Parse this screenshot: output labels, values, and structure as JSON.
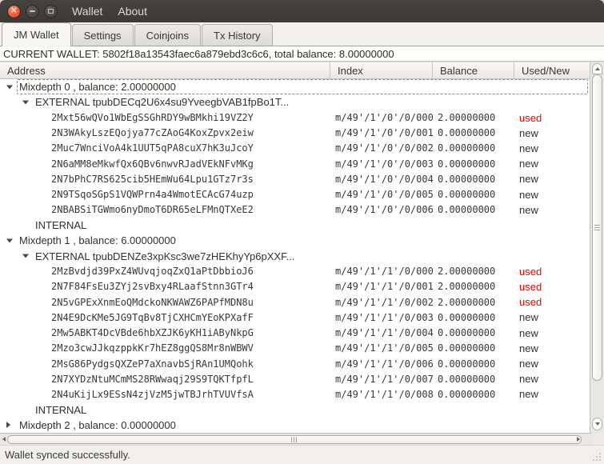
{
  "window": {
    "controls": [
      "close",
      "minimize",
      "maximize"
    ],
    "menu_items": [
      {
        "label": "Wallet"
      },
      {
        "label": "About"
      }
    ]
  },
  "tabs": [
    {
      "label": "JM Wallet",
      "active": true
    },
    {
      "label": "Settings",
      "active": false
    },
    {
      "label": "Coinjoins",
      "active": false
    },
    {
      "label": "Tx History",
      "active": false
    }
  ],
  "banner": {
    "text": "CURRENT WALLET: 5802f18a13543faec6a879ebd3c6c6, total balance: 8.00000000"
  },
  "tree": {
    "columns": [
      "Address",
      "Index",
      "Balance",
      "Used/New"
    ],
    "rows": [
      {
        "type": "mixdepth",
        "expander": "down",
        "label": "Mixdepth 0 , balance: 2.00000000",
        "focused": true
      },
      {
        "type": "branch",
        "expander": "down",
        "label": "EXTERNAL tpubDECq2U6x4su9YveegbVAB1fpBo1T..."
      },
      {
        "type": "address",
        "address": "2Mxt56wQVo1WbEgSSGhRDY9wBMkhi19VZ2Y",
        "index": "m/49'/1'/0'/0/000",
        "balance": "2.00000000",
        "status": "used"
      },
      {
        "type": "address",
        "address": "2N3WAkyLszEQojya77cZAoG4KoxZpvx2eiw",
        "index": "m/49'/1'/0'/0/001",
        "balance": "0.00000000",
        "status": "new"
      },
      {
        "type": "address",
        "address": "2Muc7WnciVoA4k1UUT5qPA8cuX7hK3uJcoY",
        "index": "m/49'/1'/0'/0/002",
        "balance": "0.00000000",
        "status": "new"
      },
      {
        "type": "address",
        "address": "2N6aMM8eMkwfQx6QBv6nwvRJadVEkNFvMKg",
        "index": "m/49'/1'/0'/0/003",
        "balance": "0.00000000",
        "status": "new"
      },
      {
        "type": "address",
        "address": "2N7bPhC7RS625cib5HEmWu64Lpu1GTz7r3s",
        "index": "m/49'/1'/0'/0/004",
        "balance": "0.00000000",
        "status": "new"
      },
      {
        "type": "address",
        "address": "2N9TSqoSGpS1VQWPrn4a4WmotECAcG74uzp",
        "index": "m/49'/1'/0'/0/005",
        "balance": "0.00000000",
        "status": "new"
      },
      {
        "type": "address",
        "address": "2NBABSiTGWmo6nyDmoT6DR65eLFMnQTXeE2",
        "index": "m/49'/1'/0'/0/006",
        "balance": "0.00000000",
        "status": "new"
      },
      {
        "type": "branch",
        "expander": null,
        "label": "INTERNAL"
      },
      {
        "type": "mixdepth",
        "expander": "down",
        "label": "Mixdepth 1 , balance: 6.00000000"
      },
      {
        "type": "branch",
        "expander": "down",
        "label": "EXTERNAL tpubDENZe3xpKsc3we7zHEKhyYp6pXXF..."
      },
      {
        "type": "address",
        "address": "2MzBvdjd39PxZ4WUvqjoqZxQ1aPtDbbioJ6",
        "index": "m/49'/1'/1'/0/000",
        "balance": "2.00000000",
        "status": "used"
      },
      {
        "type": "address",
        "address": "2N7F84FsEu3ZYj2svBxy4RLaafStnn3GTr4",
        "index": "m/49'/1'/1'/0/001",
        "balance": "2.00000000",
        "status": "used"
      },
      {
        "type": "address",
        "address": "2N5vGPExXnmEoQMdckoNKWAWZ6PAPfMDN8u",
        "index": "m/49'/1'/1'/0/002",
        "balance": "2.00000000",
        "status": "used"
      },
      {
        "type": "address",
        "address": "2N4E9DcKMe5JG9TqBv8TjCXHCmYEoKPXafF",
        "index": "m/49'/1'/1'/0/003",
        "balance": "0.00000000",
        "status": "new"
      },
      {
        "type": "address",
        "address": "2Mw5ABKT4DcVBde6hbXZJK6yKH1iAByNkpG",
        "index": "m/49'/1'/1'/0/004",
        "balance": "0.00000000",
        "status": "new"
      },
      {
        "type": "address",
        "address": "2Mzo3cwJJkqzppkKr7hEZ8ggQS8Mr8nWBWV",
        "index": "m/49'/1'/1'/0/005",
        "balance": "0.00000000",
        "status": "new"
      },
      {
        "type": "address",
        "address": "2MsG86PydgsQXZeP7aXnavbSjRAn1UMQohk",
        "index": "m/49'/1'/1'/0/006",
        "balance": "0.00000000",
        "status": "new"
      },
      {
        "type": "address",
        "address": "2N7XYDzNtuMCmMS28RWwaqj29S9TQKTfpfL",
        "index": "m/49'/1'/1'/0/007",
        "balance": "0.00000000",
        "status": "new"
      },
      {
        "type": "address",
        "address": "2N4uKijLx9ESsN4zjVzM5jwTBJrhTVUVfsA",
        "index": "m/49'/1'/1'/0/008",
        "balance": "0.00000000",
        "status": "new"
      },
      {
        "type": "branch",
        "expander": null,
        "label": "INTERNAL"
      },
      {
        "type": "mixdepth",
        "expander": "right",
        "label": "Mixdepth 2 , balance: 0.00000000"
      }
    ]
  },
  "status_bar": {
    "text": "Wallet synced successfully."
  },
  "colors": {
    "used_status": "#ef0000",
    "titlebar": "#3b3a36",
    "close_button": "#e8501f"
  }
}
